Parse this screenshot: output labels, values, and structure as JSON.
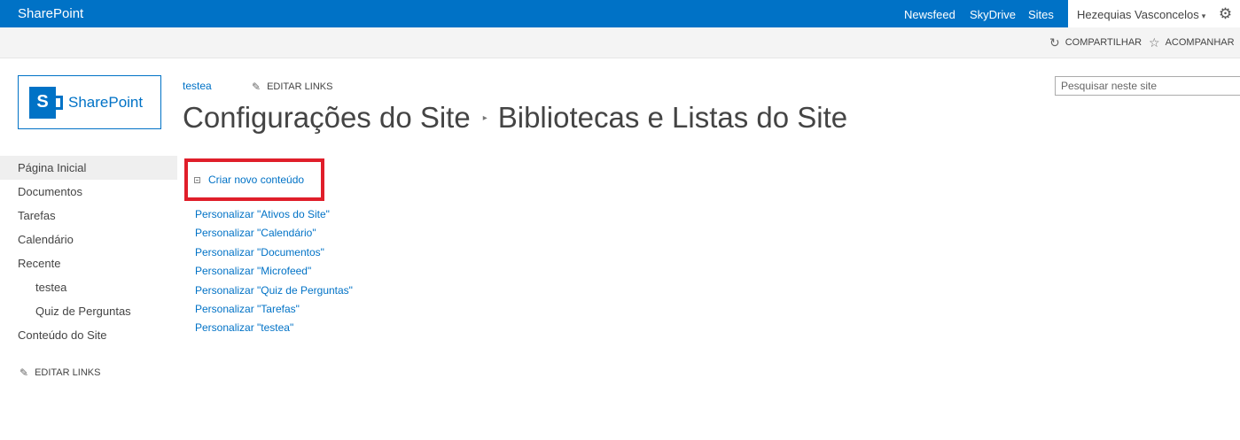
{
  "suite_bar": {
    "brand": "SharePoint",
    "links": [
      "Newsfeed",
      "SkyDrive",
      "Sites"
    ],
    "user": "Hezequias Vasconcelos",
    "caret": "▾",
    "gear": "⚙"
  },
  "ribbon": {
    "share": "COMPARTILHAR",
    "follow": "ACOMPANHAR",
    "share_icon": "↻",
    "follow_icon": "☆"
  },
  "logo": {
    "glyph": "S",
    "text": "SharePoint"
  },
  "top_nav": {
    "link": "testea",
    "edit_links": "EDITAR LINKS",
    "pencil_icon": "✎"
  },
  "search": {
    "placeholder": "Pesquisar neste site"
  },
  "title": {
    "part1": "Configurações do Site",
    "separator": "▸",
    "part2": "Bibliotecas e Listas do Site"
  },
  "left_nav": {
    "items": [
      "Página Inicial",
      "Documentos",
      "Tarefas",
      "Calendário",
      "Recente",
      "testea",
      "Quiz de Perguntas",
      "Conteúdo do Site"
    ],
    "edit_links": "EDITAR LINKS"
  },
  "main": {
    "create_new": "Criar novo conteúdo",
    "customize_links": [
      "Personalizar \"Ativos do Site\"",
      "Personalizar \"Calendário\"",
      "Personalizar \"Documentos\"",
      "Personalizar \"Microfeed\"",
      "Personalizar \"Quiz de Perguntas\"",
      "Personalizar \"Tarefas\"",
      "Personalizar \"testea\""
    ]
  },
  "colors": {
    "suite_bar": "#0072c6",
    "link": "#0072c6",
    "highlight": "#e01e2a"
  }
}
